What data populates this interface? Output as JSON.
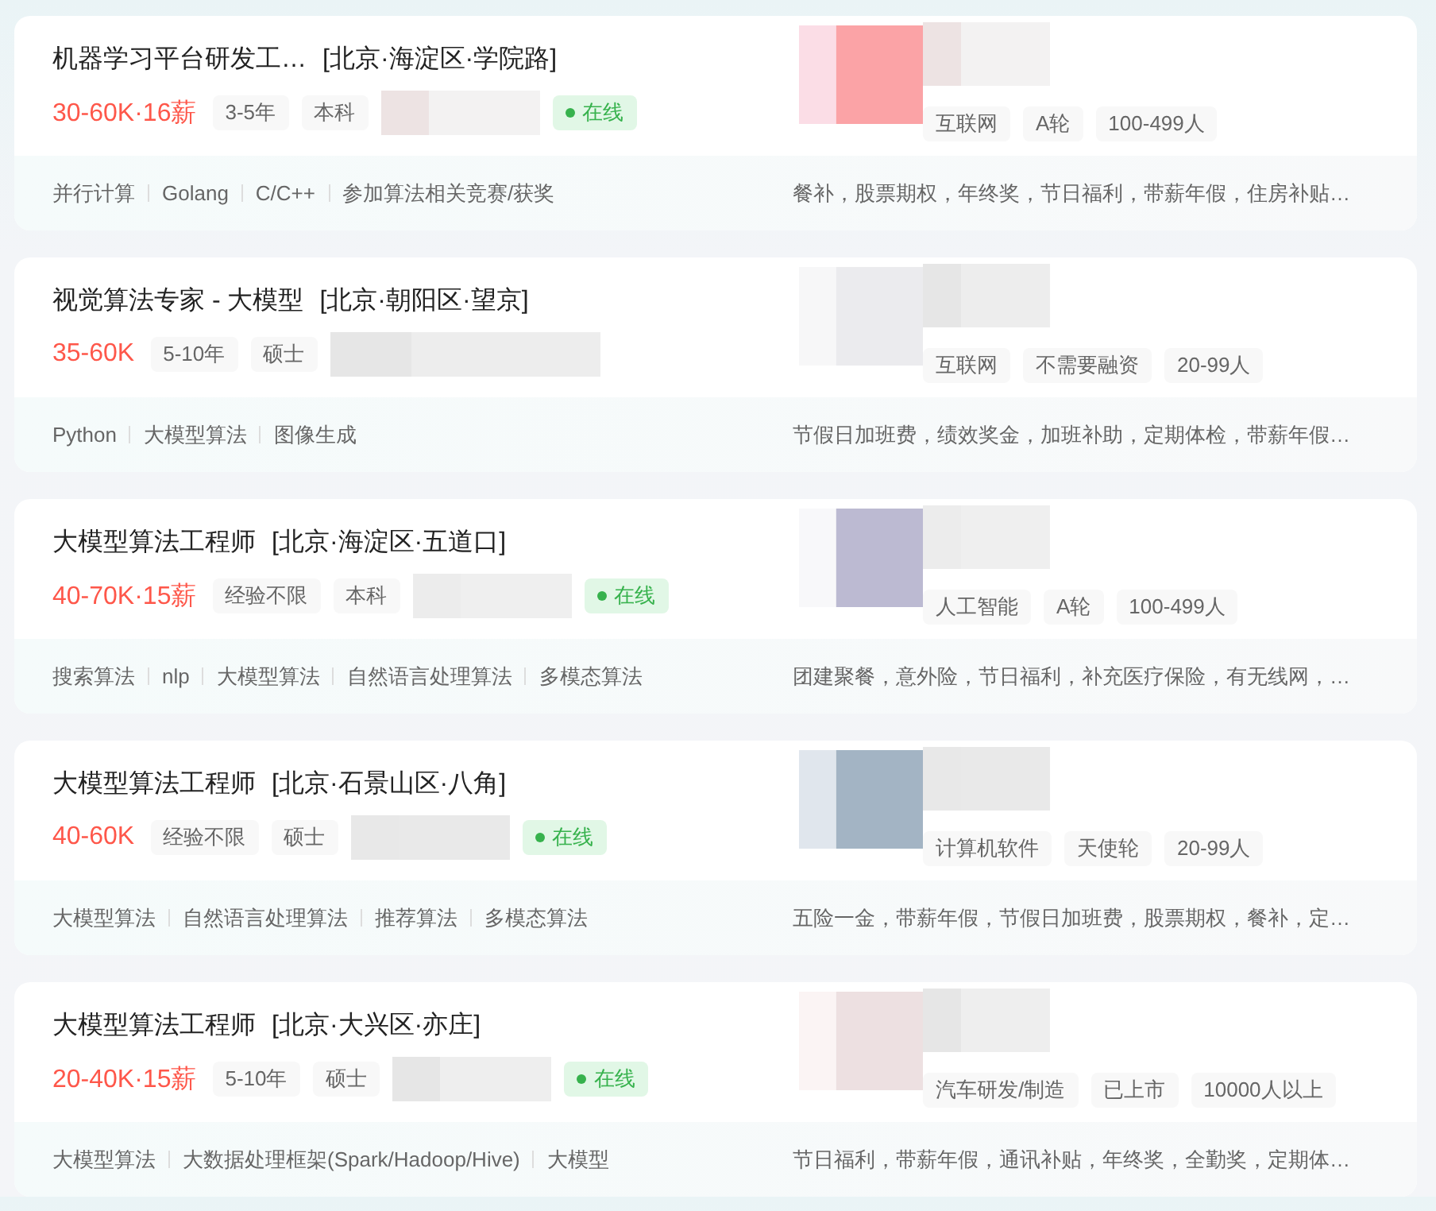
{
  "jobs": [
    {
      "title": "机器学习平台研发工…",
      "location": "[北京·海淀区·学院路]",
      "salary": "30-60K·16薪",
      "tags": [
        "3-5年",
        "本科"
      ],
      "online": "在线",
      "company_tags": [
        "互联网",
        "A轮",
        "100-499人"
      ],
      "skills": [
        "并行计算",
        "Golang",
        "C/C++",
        "参加算法相关竞赛/获奖"
      ],
      "welfare": "餐补，股票期权，年终奖，节日福利，带薪年假，住房补贴…"
    },
    {
      "title": "视觉算法专家 - 大模型",
      "location": "[北京·朝阳区·望京]",
      "salary": "35-60K",
      "tags": [
        "5-10年",
        "硕士"
      ],
      "company_tags": [
        "互联网",
        "不需要融资",
        "20-99人"
      ],
      "skills": [
        "Python",
        "大模型算法",
        "图像生成"
      ],
      "welfare": "节假日加班费，绩效奖金，加班补助，定期体检，带薪年假…"
    },
    {
      "title": "大模型算法工程师",
      "location": "[北京·海淀区·五道口]",
      "salary": "40-70K·15薪",
      "tags": [
        "经验不限",
        "本科"
      ],
      "online": "在线",
      "company_tags": [
        "人工智能",
        "A轮",
        "100-499人"
      ],
      "skills": [
        "搜索算法",
        "nlp",
        "大模型算法",
        "自然语言处理算法",
        "多模态算法"
      ],
      "welfare": "团建聚餐，意外险，节日福利，补充医疗保险，有无线网，…"
    },
    {
      "title": "大模型算法工程师",
      "location": "[北京·石景山区·八角]",
      "salary": "40-60K",
      "tags": [
        "经验不限",
        "硕士"
      ],
      "online": "在线",
      "company_tags": [
        "计算机软件",
        "天使轮",
        "20-99人"
      ],
      "skills": [
        "大模型算法",
        "自然语言处理算法",
        "推荐算法",
        "多模态算法"
      ],
      "welfare": "五险一金，带薪年假，节假日加班费，股票期权，餐补，定…"
    },
    {
      "title": "大模型算法工程师",
      "location": "[北京·大兴区·亦庄]",
      "salary": "20-40K·15薪",
      "tags": [
        "5-10年",
        "硕士"
      ],
      "online": "在线",
      "company_tags": [
        "汽车研发/制造",
        "已上市",
        "10000人以上"
      ],
      "skills": [
        "大模型算法",
        "大数据处理框架(Spark/Hadoop/Hive)",
        "大模型"
      ],
      "welfare": "节日福利，带薪年假，通讯补贴，年终奖，全勤奖，定期体…"
    }
  ]
}
